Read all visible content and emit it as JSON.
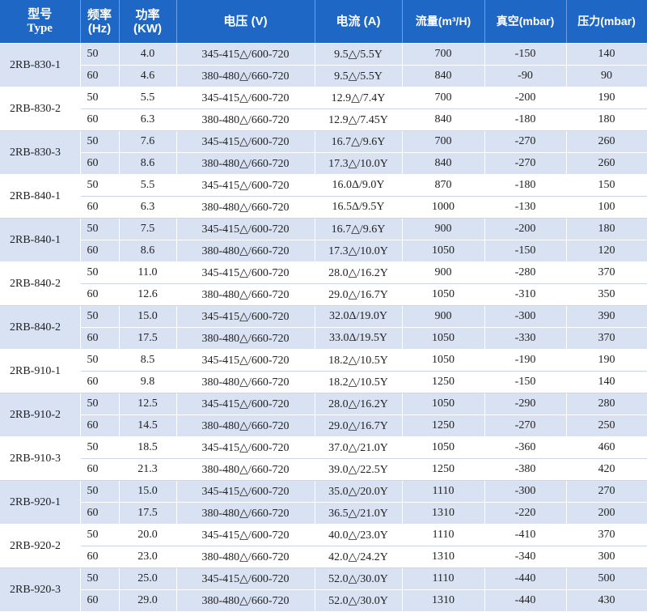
{
  "headers": {
    "type_cn": "型号",
    "type_en": "Type",
    "freq_cn": "频率",
    "freq_unit": "(Hz)",
    "power_cn": "功率",
    "power_unit": "(KW)",
    "voltage": "电压 (V)",
    "current": "电流 (A)",
    "flow": "流量(m³/H)",
    "vacuum": "真空(mbar)",
    "pressure": "压力(mbar)"
  },
  "groups": [
    {
      "model": "2RB-830-1",
      "rows": [
        {
          "freq": "50",
          "power": "4.0",
          "voltage": "345-415△/600-720",
          "current": "9.5△/5.5Y",
          "flow": "700",
          "vacuum": "-150",
          "pressure": "140"
        },
        {
          "freq": "60",
          "power": "4.6",
          "voltage": "380-480△/660-720",
          "current": "9.5△/5.5Y",
          "flow": "840",
          "vacuum": "-90",
          "pressure": "90"
        }
      ]
    },
    {
      "model": "2RB-830-2",
      "rows": [
        {
          "freq": "50",
          "power": "5.5",
          "voltage": "345-415△/600-720",
          "current": "12.9△/7.4Y",
          "flow": "700",
          "vacuum": "-200",
          "pressure": "190"
        },
        {
          "freq": "60",
          "power": "6.3",
          "voltage": "380-480△/660-720",
          "current": "12.9△/7.45Y",
          "flow": "840",
          "vacuum": "-180",
          "pressure": "180"
        }
      ]
    },
    {
      "model": "2RB-830-3",
      "rows": [
        {
          "freq": "50",
          "power": "7.6",
          "voltage": "345-415△/600-720",
          "current": "16.7△/9.6Y",
          "flow": "700",
          "vacuum": "-270",
          "pressure": "260"
        },
        {
          "freq": "60",
          "power": "8.6",
          "voltage": "380-480△/660-720",
          "current": "17.3△/10.0Y",
          "flow": "840",
          "vacuum": "-270",
          "pressure": "260"
        }
      ]
    },
    {
      "model": "2RB-840-1",
      "rows": [
        {
          "freq": "50",
          "power": "5.5",
          "voltage": "345-415△/600-720",
          "current": "16.0Δ/9.0Y",
          "flow": "870",
          "vacuum": "-180",
          "pressure": "150"
        },
        {
          "freq": "60",
          "power": "6.3",
          "voltage": "380-480△/660-720",
          "current": "16.5Δ/9.5Y",
          "flow": "1000",
          "vacuum": "-130",
          "pressure": "100"
        }
      ]
    },
    {
      "model": "2RB-840-1",
      "rows": [
        {
          "freq": "50",
          "power": "7.5",
          "voltage": "345-415△/600-720",
          "current": "16.7△/9.6Y",
          "flow": "900",
          "vacuum": "-200",
          "pressure": "180"
        },
        {
          "freq": "60",
          "power": "8.6",
          "voltage": "380-480△/660-720",
          "current": "17.3△/10.0Y",
          "flow": "1050",
          "vacuum": "-150",
          "pressure": "120"
        }
      ]
    },
    {
      "model": "2RB-840-2",
      "rows": [
        {
          "freq": "50",
          "power": "11.0",
          "voltage": "345-415△/600-720",
          "current": "28.0△/16.2Y",
          "flow": "900",
          "vacuum": "-280",
          "pressure": "370"
        },
        {
          "freq": "60",
          "power": "12.6",
          "voltage": "380-480△/660-720",
          "current": "29.0△/16.7Y",
          "flow": "1050",
          "vacuum": "-310",
          "pressure": "350"
        }
      ]
    },
    {
      "model": "2RB-840-2",
      "rows": [
        {
          "freq": "50",
          "power": "15.0",
          "voltage": "345-415△/600-720",
          "current": "32.0Δ/19.0Y",
          "flow": "900",
          "vacuum": "-300",
          "pressure": "390"
        },
        {
          "freq": "60",
          "power": "17.5",
          "voltage": "380-480△/660-720",
          "current": "33.0Δ/19.5Y",
          "flow": "1050",
          "vacuum": "-330",
          "pressure": "370"
        }
      ]
    },
    {
      "model": "2RB-910-1",
      "rows": [
        {
          "freq": "50",
          "power": "8.5",
          "voltage": "345-415△/600-720",
          "current": "18.2△/10.5Y",
          "flow": "1050",
          "vacuum": "-190",
          "pressure": "190"
        },
        {
          "freq": "60",
          "power": "9.8",
          "voltage": "380-480△/660-720",
          "current": "18.2△/10.5Y",
          "flow": "1250",
          "vacuum": "-150",
          "pressure": "140"
        }
      ]
    },
    {
      "model": "2RB-910-2",
      "rows": [
        {
          "freq": "50",
          "power": "12.5",
          "voltage": "345-415△/600-720",
          "current": "28.0△/16.2Y",
          "flow": "1050",
          "vacuum": "-290",
          "pressure": "280"
        },
        {
          "freq": "60",
          "power": "14.5",
          "voltage": "380-480△/660-720",
          "current": "29.0△/16.7Y",
          "flow": "1250",
          "vacuum": "-270",
          "pressure": "250"
        }
      ]
    },
    {
      "model": "2RB-910-3",
      "rows": [
        {
          "freq": "50",
          "power": "18.5",
          "voltage": "345-415△/600-720",
          "current": "37.0△/21.0Y",
          "flow": "1050",
          "vacuum": "-360",
          "pressure": "460"
        },
        {
          "freq": "60",
          "power": "21.3",
          "voltage": "380-480△/660-720",
          "current": "39.0△/22.5Y",
          "flow": "1250",
          "vacuum": "-380",
          "pressure": "420"
        }
      ]
    },
    {
      "model": "2RB-920-1",
      "rows": [
        {
          "freq": "50",
          "power": "15.0",
          "voltage": "345-415△/600-720",
          "current": "35.0△/20.0Y",
          "flow": "1110",
          "vacuum": "-300",
          "pressure": "270"
        },
        {
          "freq": "60",
          "power": "17.5",
          "voltage": "380-480△/660-720",
          "current": "36.5△/21.0Y",
          "flow": "1310",
          "vacuum": "-220",
          "pressure": "200"
        }
      ]
    },
    {
      "model": "2RB-920-2",
      "rows": [
        {
          "freq": "50",
          "power": "20.0",
          "voltage": "345-415△/600-720",
          "current": "40.0△/23.0Y",
          "flow": "1110",
          "vacuum": "-410",
          "pressure": "370"
        },
        {
          "freq": "60",
          "power": "23.0",
          "voltage": "380-480△/660-720",
          "current": "42.0△/24.2Y",
          "flow": "1310",
          "vacuum": "-340",
          "pressure": "300"
        }
      ]
    },
    {
      "model": "2RB-920-3",
      "rows": [
        {
          "freq": "50",
          "power": "25.0",
          "voltage": "345-415△/600-720",
          "current": "52.0△/30.0Y",
          "flow": "1110",
          "vacuum": "-440",
          "pressure": "500"
        },
        {
          "freq": "60",
          "power": "29.0",
          "voltage": "380-480△/660-720",
          "current": "52.0△/30.0Y",
          "flow": "1310",
          "vacuum": "-440",
          "pressure": "430"
        }
      ]
    }
  ]
}
